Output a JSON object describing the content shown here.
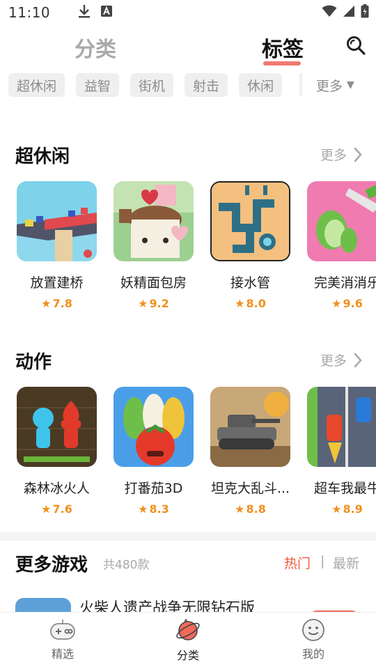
{
  "status": {
    "time": "11:10"
  },
  "top_tabs": {
    "category": "分类",
    "tags": "标签"
  },
  "tags": [
    "超休闲",
    "益智",
    "街机",
    "射击",
    "休闲"
  ],
  "tags_more": "更多",
  "sections": [
    {
      "title": "超休闲",
      "more": "更多",
      "games": [
        {
          "name": "放置建桥",
          "rating": "7.8"
        },
        {
          "name": "妖精面包房",
          "rating": "9.2"
        },
        {
          "name": "接水管",
          "rating": "8.0"
        },
        {
          "name": "完美消消乐",
          "rating": "9.6"
        }
      ]
    },
    {
      "title": "动作",
      "more": "更多",
      "games": [
        {
          "name": "森林冰火人",
          "rating": "7.6"
        },
        {
          "name": "打番茄3D",
          "rating": "8.3"
        },
        {
          "name": "坦克大乱斗...",
          "rating": "8.8"
        },
        {
          "name": "超车我最牛",
          "rating": "8.9"
        }
      ]
    }
  ],
  "more_games": {
    "title": "更多游戏",
    "count": "共480款",
    "sort_hot": "热门",
    "sort_sep": "|",
    "sort_new": "最新",
    "first_item_name": "火柴人遗产战争无限钻石版"
  },
  "bottom_nav": [
    {
      "label": "精选",
      "icon": "gamepad-icon"
    },
    {
      "label": "分类",
      "icon": "planet-icon"
    },
    {
      "label": "我的",
      "icon": "smiley-icon"
    }
  ],
  "colors": {
    "accent": "#f07a72",
    "rating": "#f0911e",
    "hot": "#f05a3c"
  }
}
